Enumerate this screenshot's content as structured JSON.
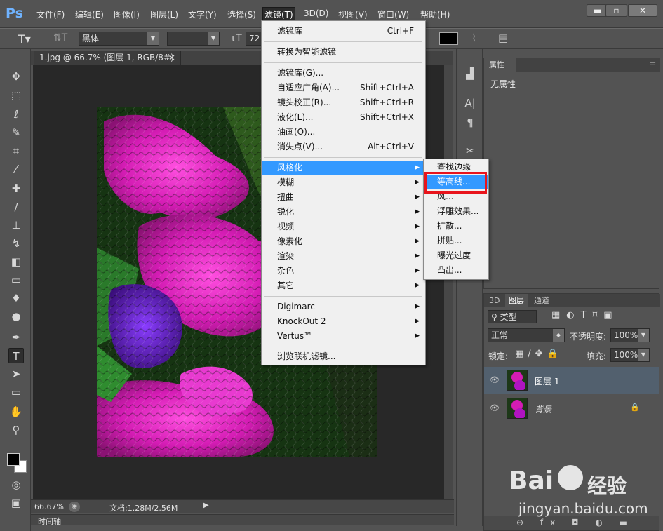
{
  "app": {
    "logo": "Ps"
  },
  "menubar": [
    "文件(F)",
    "编辑(E)",
    "图像(I)",
    "图层(L)",
    "文字(Y)",
    "选择(S)",
    "滤镜(T)",
    "3D(D)",
    "视图(V)",
    "窗口(W)",
    "帮助(H)"
  ],
  "window_controls": {
    "minimize": "▬",
    "restore": "▫",
    "close": "✕"
  },
  "options": {
    "font_family": "黑体",
    "font_style": "-",
    "font_size": "72",
    "colors": {
      "swatch": "#000000"
    }
  },
  "document": {
    "tab_title": "1.jpg @ 66.7% (图层 1, RGB/8#) *",
    "tab_close": "×",
    "zoom": "66.67%",
    "doc_info": "文档:1.28M/2.56M",
    "timeline": "时间轴"
  },
  "filter_menu": {
    "items": [
      {
        "label": "滤镜库",
        "shortcut": "Ctrl+F"
      },
      {
        "label": "转换为智能滤镜"
      },
      {
        "label": "滤镜库(G)..."
      },
      {
        "label": "自适应广角(A)...",
        "shortcut": "Shift+Ctrl+A"
      },
      {
        "label": "镜头校正(R)...",
        "shortcut": "Shift+Ctrl+R"
      },
      {
        "label": "液化(L)...",
        "shortcut": "Shift+Ctrl+X"
      },
      {
        "label": "油画(O)..."
      },
      {
        "label": "消失点(V)...",
        "shortcut": "Alt+Ctrl+V"
      },
      {
        "label": "风格化",
        "submenu": true,
        "highlight": true
      },
      {
        "label": "模糊",
        "submenu": true
      },
      {
        "label": "扭曲",
        "submenu": true
      },
      {
        "label": "锐化",
        "submenu": true
      },
      {
        "label": "视频",
        "submenu": true
      },
      {
        "label": "像素化",
        "submenu": true
      },
      {
        "label": "渲染",
        "submenu": true
      },
      {
        "label": "杂色",
        "submenu": true
      },
      {
        "label": "其它",
        "submenu": true
      },
      {
        "label": "Digimarc",
        "submenu": true
      },
      {
        "label": "KnockOut 2",
        "submenu": true
      },
      {
        "label": "Vertus™",
        "submenu": true
      },
      {
        "label": "浏览联机滤镜..."
      }
    ]
  },
  "stylize_submenu": [
    "查找边缘",
    "等高线...",
    "风...",
    "浮雕效果...",
    "扩散...",
    "拼贴...",
    "曝光过度",
    "凸出..."
  ],
  "properties": {
    "tab": "属性",
    "content": "无属性"
  },
  "layers_panel": {
    "tabs": [
      "3D",
      "图层",
      "通道"
    ],
    "filter_kind": "类型",
    "blend_mode": "正常",
    "opacity_label": "不透明度:",
    "opacity": "100%",
    "lock_label": "锁定:",
    "fill_label": "填充:",
    "fill": "100%",
    "layers": [
      {
        "name": "图层 1",
        "selected": true
      },
      {
        "name": "背景",
        "locked": true
      }
    ]
  },
  "watermark": {
    "brand": "Bai",
    "brand2": "经验",
    "url": "jingyan.baidu.com"
  },
  "colors": {
    "highlight": "#3399ff",
    "callout": "#e8141c"
  }
}
